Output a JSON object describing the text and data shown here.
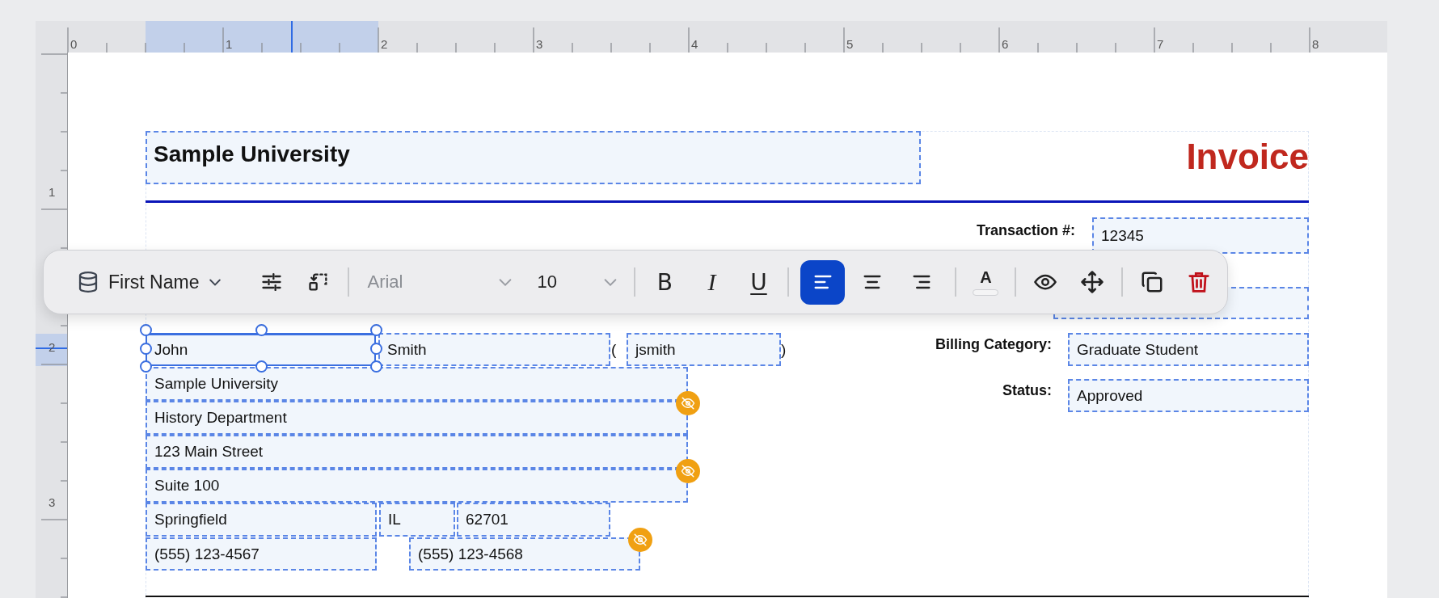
{
  "rulers": {
    "horizontal": [
      "0",
      "1",
      "2",
      "3",
      "4",
      "5",
      "6",
      "7",
      "8"
    ],
    "vertical": [
      "1",
      "2",
      "3"
    ]
  },
  "header": {
    "title": "Sample University",
    "heading": "Invoice"
  },
  "summary_fields": [
    {
      "kind": "labeled",
      "label": "Transaction #:",
      "value": "12345"
    },
    {
      "kind": "covered"
    },
    {
      "kind": "labeled",
      "label": "Billing Category:",
      "value": "Graduate Student"
    },
    {
      "kind": "labeled",
      "label": "Status:",
      "value": "Approved"
    }
  ],
  "fields": [
    {
      "kind": "field",
      "value": "John",
      "selected": true,
      "hidden": false
    },
    {
      "kind": "field",
      "value": "Smith",
      "selected": false,
      "hidden": false
    },
    {
      "kind": "text",
      "value": "("
    },
    {
      "kind": "field",
      "value": "jsmith",
      "selected": false,
      "hidden": false
    },
    {
      "kind": "text",
      "value": ")"
    },
    {
      "kind": "field",
      "value": "Sample University",
      "selected": false,
      "hidden": false
    },
    {
      "kind": "field",
      "value": "History Department",
      "selected": false,
      "hidden": true
    },
    {
      "kind": "field",
      "value": "123 Main Street",
      "selected": false,
      "hidden": false
    },
    {
      "kind": "field",
      "value": "Suite 100",
      "selected": false,
      "hidden": true
    },
    {
      "kind": "field",
      "value": "Springfield",
      "selected": false,
      "hidden": false
    },
    {
      "kind": "field",
      "value": "IL",
      "selected": false,
      "hidden": false
    },
    {
      "kind": "field",
      "value": "62701",
      "selected": false,
      "hidden": false
    },
    {
      "kind": "field",
      "value": "(555) 123-4567",
      "selected": false,
      "hidden": false
    },
    {
      "kind": "field",
      "value": "(555) 123-4568",
      "selected": false,
      "hidden": true
    }
  ],
  "toolbar": {
    "data_field": "First Name",
    "font": "Arial",
    "size": "10",
    "format_buttons": [
      {
        "kind": "bold",
        "label": "B"
      },
      {
        "kind": "italic",
        "label": "I"
      },
      {
        "kind": "underline",
        "label": "U"
      }
    ],
    "align_buttons": [
      {
        "kind": "left",
        "selected": true
      },
      {
        "kind": "center",
        "selected": false
      },
      {
        "kind": "right",
        "selected": false
      }
    ],
    "text_color_label": "A"
  }
}
